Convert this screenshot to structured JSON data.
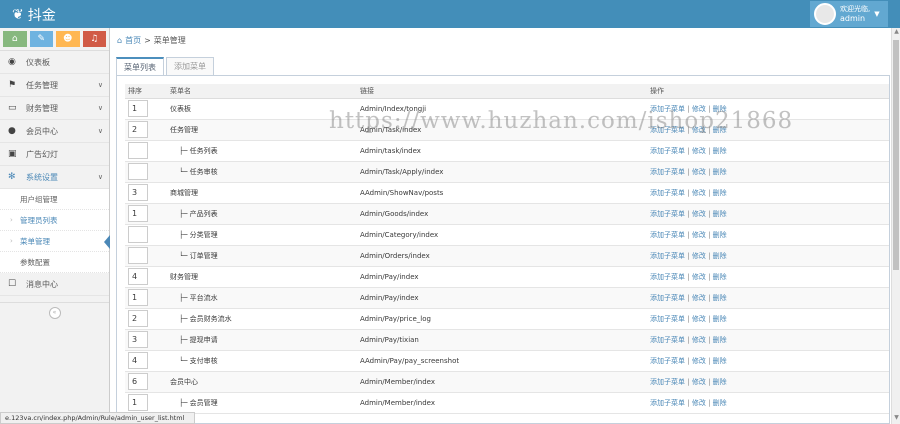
{
  "app": {
    "brand": "抖金",
    "welcome": "欢迎光临,",
    "username": "admin"
  },
  "colors": {
    "topbar": "#438eb9",
    "accent": "#4b88b7",
    "shortcut_green": "#87b87f",
    "shortcut_blue": "#6fb3e0",
    "shortcut_orange": "#ffb752",
    "shortcut_red": "#d15b47"
  },
  "sidebar": {
    "shortcuts": [
      {
        "icon": "home-icon",
        "glyph": "⌂"
      },
      {
        "icon": "pencil-icon",
        "glyph": "✎"
      },
      {
        "icon": "users-icon",
        "glyph": "☻"
      },
      {
        "icon": "bell-icon",
        "glyph": "♫"
      }
    ],
    "items": [
      {
        "label": "仪表板",
        "icon": "dashboard-icon"
      },
      {
        "label": "任务管理",
        "icon": "flag-icon"
      },
      {
        "label": "财务管理",
        "icon": "inbox-icon"
      },
      {
        "label": "会员中心",
        "icon": "user-icon"
      },
      {
        "label": "广告幻灯",
        "icon": "picture-icon"
      },
      {
        "label": "系统设置",
        "icon": "gear-icon"
      },
      {
        "label": "消息中心",
        "icon": "bookmark-icon"
      }
    ],
    "subitems": [
      "用户组管理",
      "管理员列表",
      "菜单管理",
      "参数配置"
    ]
  },
  "breadcrumb": {
    "home": "首页",
    "separator": ">",
    "current": "菜单管理"
  },
  "tabs": [
    "菜单列表",
    "添加菜单"
  ],
  "table": {
    "headers": [
      "排序",
      "菜单名",
      "链接",
      "操作"
    ],
    "action_labels": {
      "add_child": "添加子菜单",
      "edit": "修改",
      "delete": "删除",
      "sep": "|"
    },
    "rows": [
      {
        "sort": "1",
        "name": "仪表板",
        "link": "Admin/Index/tongji",
        "child": false
      },
      {
        "sort": "2",
        "name": "任务管理",
        "link": "Admin/Task/index",
        "child": false
      },
      {
        "sort": "",
        "name": "├─ 任务列表",
        "link": "Admin/task/index",
        "child": true
      },
      {
        "sort": "",
        "name": "└─ 任务审核",
        "link": "Admin/Task/Apply/index",
        "child": true
      },
      {
        "sort": "3",
        "name": "商城管理",
        "link": "AAdmin/ShowNav/posts",
        "child": false
      },
      {
        "sort": "1",
        "name": "├─ 产品列表",
        "link": "Admin/Goods/index",
        "child": true
      },
      {
        "sort": "",
        "name": "├─ 分类管理",
        "link": "Admin/Category/index",
        "child": true
      },
      {
        "sort": "",
        "name": "└─ 订单管理",
        "link": "Admin/Orders/index",
        "child": true
      },
      {
        "sort": "4",
        "name": "财务管理",
        "link": "Admin/Pay/index",
        "child": false
      },
      {
        "sort": "1",
        "name": "├─ 平台流水",
        "link": "Admin/Pay/index",
        "child": true
      },
      {
        "sort": "2",
        "name": "├─ 会员财务流水",
        "link": "Admin/Pay/price_log",
        "child": true
      },
      {
        "sort": "3",
        "name": "├─ 提现申请",
        "link": "Admin/Pay/tixian",
        "child": true
      },
      {
        "sort": "4",
        "name": "└─ 支付审核",
        "link": "AAdmin/Pay/pay_screenshot",
        "child": true
      },
      {
        "sort": "6",
        "name": "会员中心",
        "link": "Admin/Member/index",
        "child": false
      },
      {
        "sort": "1",
        "name": "├─ 会员管理",
        "link": "Admin/Member/index",
        "child": true
      }
    ]
  },
  "statusbar": "e.123va.cn/index.php/Admin/Rule/admin_user_list.html",
  "watermark": "https://www.huzhan.com/ishop21868"
}
